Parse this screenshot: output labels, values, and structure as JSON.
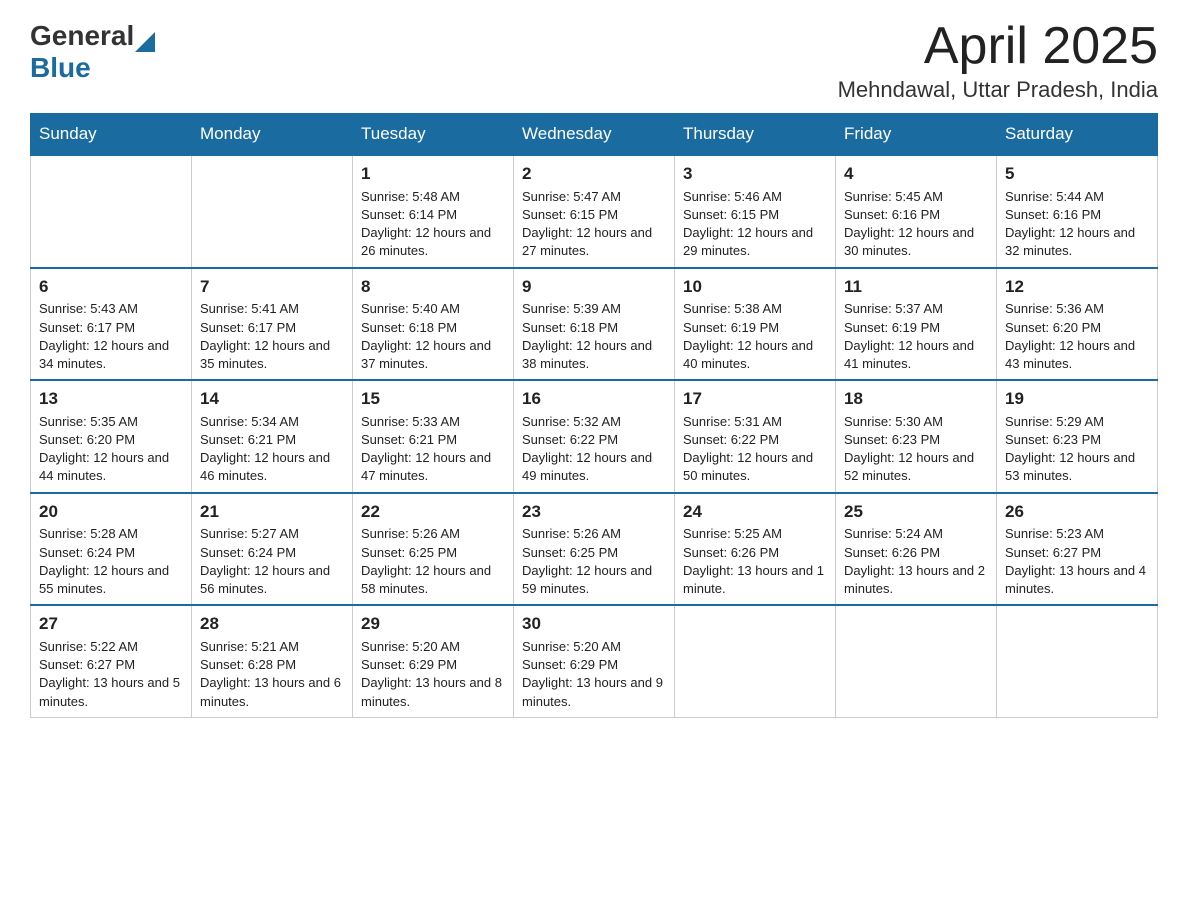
{
  "header": {
    "logo_general": "General",
    "logo_blue": "Blue",
    "month_year": "April 2025",
    "location": "Mehndawal, Uttar Pradesh, India"
  },
  "days_of_week": [
    "Sunday",
    "Monday",
    "Tuesday",
    "Wednesday",
    "Thursday",
    "Friday",
    "Saturday"
  ],
  "weeks": [
    [
      {
        "day": "",
        "info": ""
      },
      {
        "day": "",
        "info": ""
      },
      {
        "day": "1",
        "info": "Sunrise: 5:48 AM\nSunset: 6:14 PM\nDaylight: 12 hours and 26 minutes."
      },
      {
        "day": "2",
        "info": "Sunrise: 5:47 AM\nSunset: 6:15 PM\nDaylight: 12 hours and 27 minutes."
      },
      {
        "day": "3",
        "info": "Sunrise: 5:46 AM\nSunset: 6:15 PM\nDaylight: 12 hours and 29 minutes."
      },
      {
        "day": "4",
        "info": "Sunrise: 5:45 AM\nSunset: 6:16 PM\nDaylight: 12 hours and 30 minutes."
      },
      {
        "day": "5",
        "info": "Sunrise: 5:44 AM\nSunset: 6:16 PM\nDaylight: 12 hours and 32 minutes."
      }
    ],
    [
      {
        "day": "6",
        "info": "Sunrise: 5:43 AM\nSunset: 6:17 PM\nDaylight: 12 hours and 34 minutes."
      },
      {
        "day": "7",
        "info": "Sunrise: 5:41 AM\nSunset: 6:17 PM\nDaylight: 12 hours and 35 minutes."
      },
      {
        "day": "8",
        "info": "Sunrise: 5:40 AM\nSunset: 6:18 PM\nDaylight: 12 hours and 37 minutes."
      },
      {
        "day": "9",
        "info": "Sunrise: 5:39 AM\nSunset: 6:18 PM\nDaylight: 12 hours and 38 minutes."
      },
      {
        "day": "10",
        "info": "Sunrise: 5:38 AM\nSunset: 6:19 PM\nDaylight: 12 hours and 40 minutes."
      },
      {
        "day": "11",
        "info": "Sunrise: 5:37 AM\nSunset: 6:19 PM\nDaylight: 12 hours and 41 minutes."
      },
      {
        "day": "12",
        "info": "Sunrise: 5:36 AM\nSunset: 6:20 PM\nDaylight: 12 hours and 43 minutes."
      }
    ],
    [
      {
        "day": "13",
        "info": "Sunrise: 5:35 AM\nSunset: 6:20 PM\nDaylight: 12 hours and 44 minutes."
      },
      {
        "day": "14",
        "info": "Sunrise: 5:34 AM\nSunset: 6:21 PM\nDaylight: 12 hours and 46 minutes."
      },
      {
        "day": "15",
        "info": "Sunrise: 5:33 AM\nSunset: 6:21 PM\nDaylight: 12 hours and 47 minutes."
      },
      {
        "day": "16",
        "info": "Sunrise: 5:32 AM\nSunset: 6:22 PM\nDaylight: 12 hours and 49 minutes."
      },
      {
        "day": "17",
        "info": "Sunrise: 5:31 AM\nSunset: 6:22 PM\nDaylight: 12 hours and 50 minutes."
      },
      {
        "day": "18",
        "info": "Sunrise: 5:30 AM\nSunset: 6:23 PM\nDaylight: 12 hours and 52 minutes."
      },
      {
        "day": "19",
        "info": "Sunrise: 5:29 AM\nSunset: 6:23 PM\nDaylight: 12 hours and 53 minutes."
      }
    ],
    [
      {
        "day": "20",
        "info": "Sunrise: 5:28 AM\nSunset: 6:24 PM\nDaylight: 12 hours and 55 minutes."
      },
      {
        "day": "21",
        "info": "Sunrise: 5:27 AM\nSunset: 6:24 PM\nDaylight: 12 hours and 56 minutes."
      },
      {
        "day": "22",
        "info": "Sunrise: 5:26 AM\nSunset: 6:25 PM\nDaylight: 12 hours and 58 minutes."
      },
      {
        "day": "23",
        "info": "Sunrise: 5:26 AM\nSunset: 6:25 PM\nDaylight: 12 hours and 59 minutes."
      },
      {
        "day": "24",
        "info": "Sunrise: 5:25 AM\nSunset: 6:26 PM\nDaylight: 13 hours and 1 minute."
      },
      {
        "day": "25",
        "info": "Sunrise: 5:24 AM\nSunset: 6:26 PM\nDaylight: 13 hours and 2 minutes."
      },
      {
        "day": "26",
        "info": "Sunrise: 5:23 AM\nSunset: 6:27 PM\nDaylight: 13 hours and 4 minutes."
      }
    ],
    [
      {
        "day": "27",
        "info": "Sunrise: 5:22 AM\nSunset: 6:27 PM\nDaylight: 13 hours and 5 minutes."
      },
      {
        "day": "28",
        "info": "Sunrise: 5:21 AM\nSunset: 6:28 PM\nDaylight: 13 hours and 6 minutes."
      },
      {
        "day": "29",
        "info": "Sunrise: 5:20 AM\nSunset: 6:29 PM\nDaylight: 13 hours and 8 minutes."
      },
      {
        "day": "30",
        "info": "Sunrise: 5:20 AM\nSunset: 6:29 PM\nDaylight: 13 hours and 9 minutes."
      },
      {
        "day": "",
        "info": ""
      },
      {
        "day": "",
        "info": ""
      },
      {
        "day": "",
        "info": ""
      }
    ]
  ]
}
